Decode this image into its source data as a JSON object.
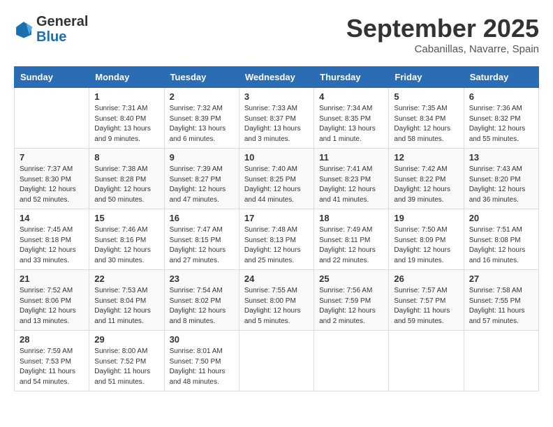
{
  "header": {
    "logo_general": "General",
    "logo_blue": "Blue",
    "month_title": "September 2025",
    "location": "Cabanillas, Navarre, Spain"
  },
  "days_of_week": [
    "Sunday",
    "Monday",
    "Tuesday",
    "Wednesday",
    "Thursday",
    "Friday",
    "Saturday"
  ],
  "weeks": [
    [
      {
        "day": "",
        "info": ""
      },
      {
        "day": "1",
        "info": "Sunrise: 7:31 AM\nSunset: 8:40 PM\nDaylight: 13 hours\nand 9 minutes."
      },
      {
        "day": "2",
        "info": "Sunrise: 7:32 AM\nSunset: 8:39 PM\nDaylight: 13 hours\nand 6 minutes."
      },
      {
        "day": "3",
        "info": "Sunrise: 7:33 AM\nSunset: 8:37 PM\nDaylight: 13 hours\nand 3 minutes."
      },
      {
        "day": "4",
        "info": "Sunrise: 7:34 AM\nSunset: 8:35 PM\nDaylight: 13 hours\nand 1 minute."
      },
      {
        "day": "5",
        "info": "Sunrise: 7:35 AM\nSunset: 8:34 PM\nDaylight: 12 hours\nand 58 minutes."
      },
      {
        "day": "6",
        "info": "Sunrise: 7:36 AM\nSunset: 8:32 PM\nDaylight: 12 hours\nand 55 minutes."
      }
    ],
    [
      {
        "day": "7",
        "info": "Sunrise: 7:37 AM\nSunset: 8:30 PM\nDaylight: 12 hours\nand 52 minutes."
      },
      {
        "day": "8",
        "info": "Sunrise: 7:38 AM\nSunset: 8:28 PM\nDaylight: 12 hours\nand 50 minutes."
      },
      {
        "day": "9",
        "info": "Sunrise: 7:39 AM\nSunset: 8:27 PM\nDaylight: 12 hours\nand 47 minutes."
      },
      {
        "day": "10",
        "info": "Sunrise: 7:40 AM\nSunset: 8:25 PM\nDaylight: 12 hours\nand 44 minutes."
      },
      {
        "day": "11",
        "info": "Sunrise: 7:41 AM\nSunset: 8:23 PM\nDaylight: 12 hours\nand 41 minutes."
      },
      {
        "day": "12",
        "info": "Sunrise: 7:42 AM\nSunset: 8:22 PM\nDaylight: 12 hours\nand 39 minutes."
      },
      {
        "day": "13",
        "info": "Sunrise: 7:43 AM\nSunset: 8:20 PM\nDaylight: 12 hours\nand 36 minutes."
      }
    ],
    [
      {
        "day": "14",
        "info": "Sunrise: 7:45 AM\nSunset: 8:18 PM\nDaylight: 12 hours\nand 33 minutes."
      },
      {
        "day": "15",
        "info": "Sunrise: 7:46 AM\nSunset: 8:16 PM\nDaylight: 12 hours\nand 30 minutes."
      },
      {
        "day": "16",
        "info": "Sunrise: 7:47 AM\nSunset: 8:15 PM\nDaylight: 12 hours\nand 27 minutes."
      },
      {
        "day": "17",
        "info": "Sunrise: 7:48 AM\nSunset: 8:13 PM\nDaylight: 12 hours\nand 25 minutes."
      },
      {
        "day": "18",
        "info": "Sunrise: 7:49 AM\nSunset: 8:11 PM\nDaylight: 12 hours\nand 22 minutes."
      },
      {
        "day": "19",
        "info": "Sunrise: 7:50 AM\nSunset: 8:09 PM\nDaylight: 12 hours\nand 19 minutes."
      },
      {
        "day": "20",
        "info": "Sunrise: 7:51 AM\nSunset: 8:08 PM\nDaylight: 12 hours\nand 16 minutes."
      }
    ],
    [
      {
        "day": "21",
        "info": "Sunrise: 7:52 AM\nSunset: 8:06 PM\nDaylight: 12 hours\nand 13 minutes."
      },
      {
        "day": "22",
        "info": "Sunrise: 7:53 AM\nSunset: 8:04 PM\nDaylight: 12 hours\nand 11 minutes."
      },
      {
        "day": "23",
        "info": "Sunrise: 7:54 AM\nSunset: 8:02 PM\nDaylight: 12 hours\nand 8 minutes."
      },
      {
        "day": "24",
        "info": "Sunrise: 7:55 AM\nSunset: 8:00 PM\nDaylight: 12 hours\nand 5 minutes."
      },
      {
        "day": "25",
        "info": "Sunrise: 7:56 AM\nSunset: 7:59 PM\nDaylight: 12 hours\nand 2 minutes."
      },
      {
        "day": "26",
        "info": "Sunrise: 7:57 AM\nSunset: 7:57 PM\nDaylight: 11 hours\nand 59 minutes."
      },
      {
        "day": "27",
        "info": "Sunrise: 7:58 AM\nSunset: 7:55 PM\nDaylight: 11 hours\nand 57 minutes."
      }
    ],
    [
      {
        "day": "28",
        "info": "Sunrise: 7:59 AM\nSunset: 7:53 PM\nDaylight: 11 hours\nand 54 minutes."
      },
      {
        "day": "29",
        "info": "Sunrise: 8:00 AM\nSunset: 7:52 PM\nDaylight: 11 hours\nand 51 minutes."
      },
      {
        "day": "30",
        "info": "Sunrise: 8:01 AM\nSunset: 7:50 PM\nDaylight: 11 hours\nand 48 minutes."
      },
      {
        "day": "",
        "info": ""
      },
      {
        "day": "",
        "info": ""
      },
      {
        "day": "",
        "info": ""
      },
      {
        "day": "",
        "info": ""
      }
    ]
  ]
}
